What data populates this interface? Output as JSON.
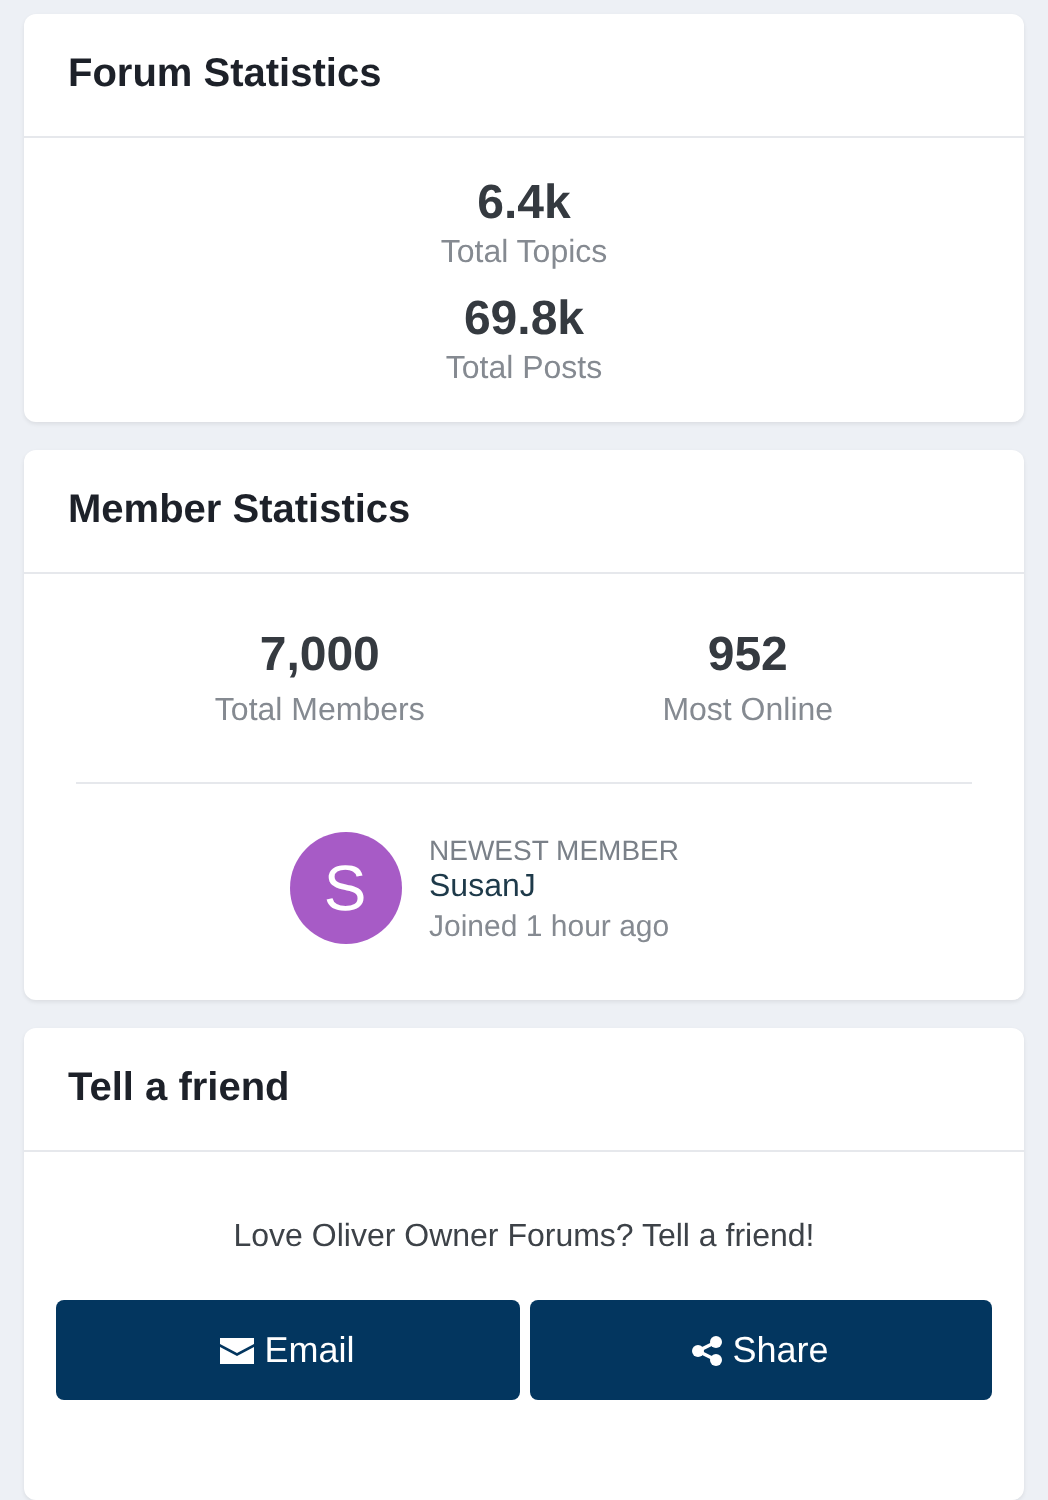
{
  "forum_statistics": {
    "title": "Forum Statistics",
    "stats": [
      {
        "value": "6.4k",
        "label": "Total Topics"
      },
      {
        "value": "69.8k",
        "label": "Total Posts"
      }
    ]
  },
  "member_statistics": {
    "title": "Member Statistics",
    "stats": [
      {
        "value": "7,000",
        "label": "Total Members"
      },
      {
        "value": "952",
        "label": "Most Online"
      }
    ],
    "newest_member": {
      "heading": "NEWEST MEMBER",
      "avatar_letter": "S",
      "name": "SusanJ",
      "joined": "Joined 1 hour ago"
    }
  },
  "tell_a_friend": {
    "title": "Tell a friend",
    "message": "Love Oliver Owner Forums? Tell a friend!",
    "buttons": [
      {
        "kind": "email",
        "label": "Email"
      },
      {
        "kind": "share",
        "label": "Share"
      }
    ]
  }
}
